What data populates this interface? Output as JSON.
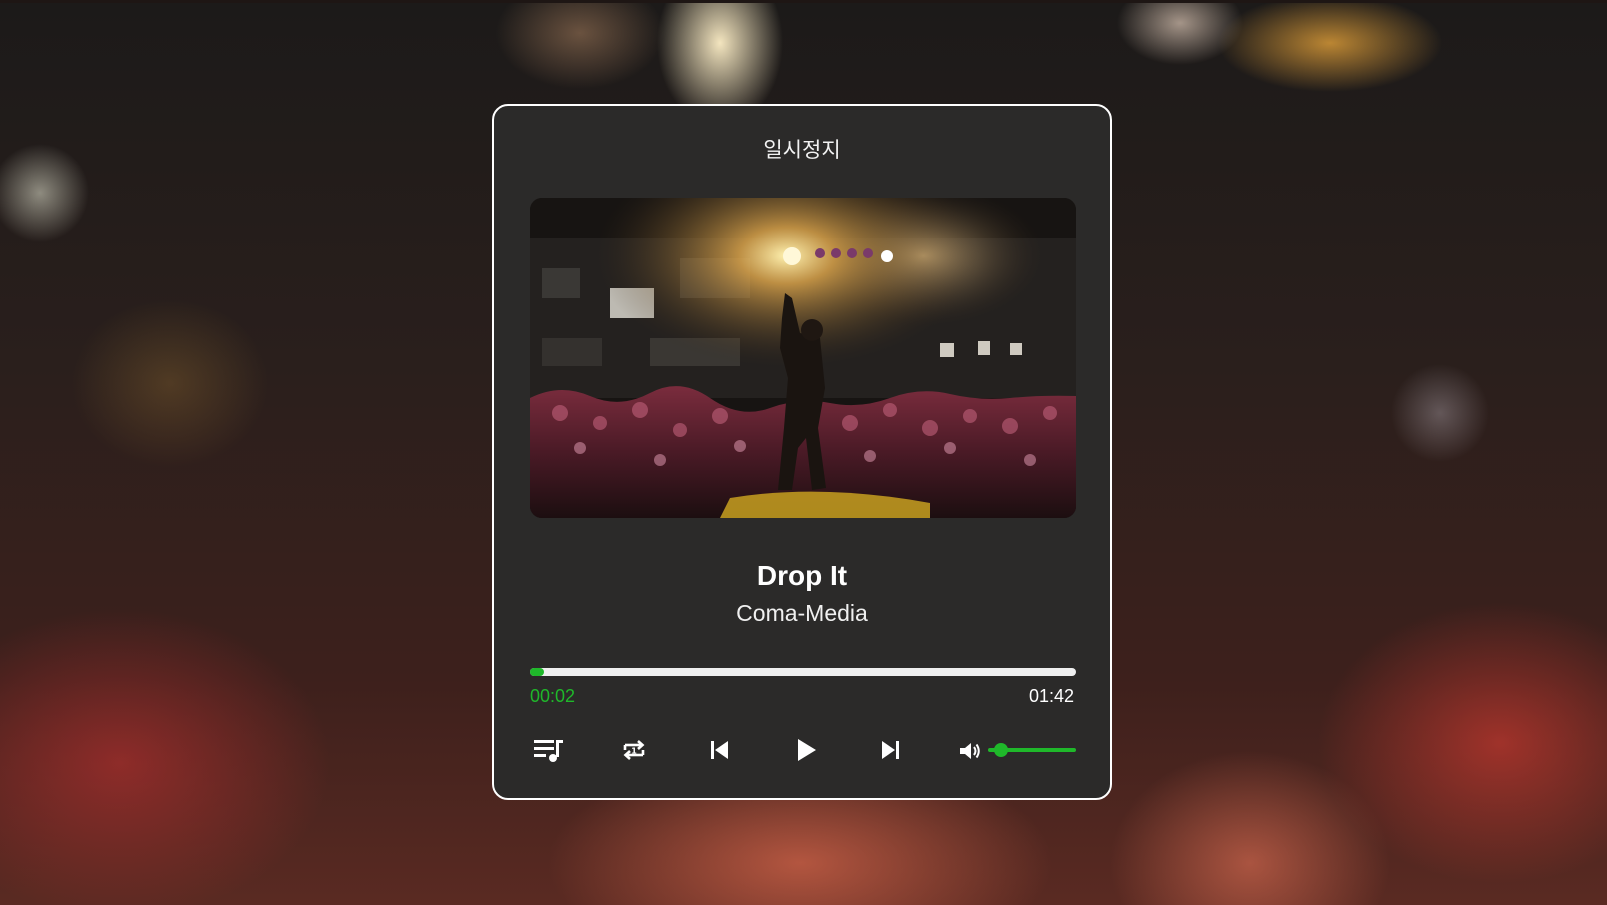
{
  "player": {
    "status_label": "일시정지",
    "track": {
      "title": "Drop It",
      "artist": "Coma-Media"
    },
    "progress": {
      "current_time": "00:02",
      "total_time": "01:42",
      "fraction": 0.02
    },
    "volume": {
      "level": 0.15
    },
    "controls": [
      {
        "name": "playlist-button",
        "icon": "playlist-icon"
      },
      {
        "name": "repeat-one-button",
        "icon": "repeat-one-icon"
      },
      {
        "name": "previous-track-button",
        "icon": "skip-previous-icon"
      },
      {
        "name": "play-button",
        "icon": "play-icon"
      },
      {
        "name": "next-track-button",
        "icon": "skip-next-icon"
      }
    ],
    "cover_art": {
      "icon": "concert-photo"
    },
    "colors": {
      "accent": "#1fb82a",
      "panel": "#2b2a29",
      "border": "#ffffff"
    }
  }
}
